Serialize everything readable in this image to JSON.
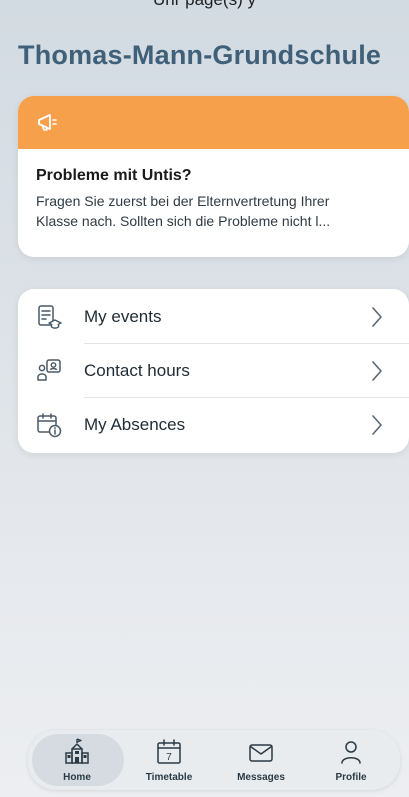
{
  "status_bar": {
    "cropped_text": "Uhr page(s) y"
  },
  "header": {
    "school_name": "Thomas-Mann-Grundschule"
  },
  "news": {
    "icon": "megaphone-icon",
    "banner_color": "#f6a04c",
    "title": "Probleme mit Untis?",
    "text_line1": "Fragen Sie zuerst bei der Elternvertretung Ihrer",
    "text_line2": "Klasse nach. Sollten sich die Probleme nicht l..."
  },
  "menu": {
    "items": [
      {
        "label": "My events",
        "icon": "events-list-icon"
      },
      {
        "label": "Contact hours",
        "icon": "contact-hours-icon"
      },
      {
        "label": "My Absences",
        "icon": "absences-calendar-icon"
      }
    ]
  },
  "bottom_nav": {
    "items": [
      {
        "label": "Home",
        "icon": "school-icon",
        "active": true
      },
      {
        "label": "Timetable",
        "icon": "calendar-icon",
        "badge": "7"
      },
      {
        "label": "Messages",
        "icon": "envelope-icon"
      },
      {
        "label": "Profile",
        "icon": "person-icon"
      }
    ]
  }
}
